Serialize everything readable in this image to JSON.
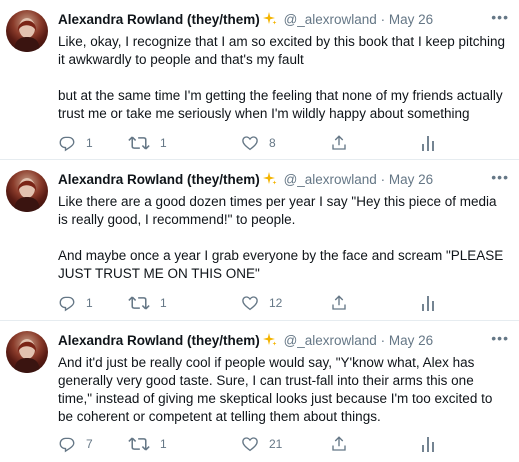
{
  "tweets": [
    {
      "author": "Alexandra Rowland (they/them)",
      "handle": "@_alexrowland",
      "separator": "·",
      "date": "May 26",
      "paragraphs": [
        "Like, okay, I recognize that I am so excited by this book that I keep pitching it awkwardly to people and that's my fault",
        "but at the same time I'm getting the feeling that none of my friends actually trust me or take me seriously when I'm wildly happy about something"
      ],
      "replies": "1",
      "retweets": "1",
      "likes": "8"
    },
    {
      "author": "Alexandra Rowland (they/them)",
      "handle": "@_alexrowland",
      "separator": "·",
      "date": "May 26",
      "paragraphs": [
        "Like there are a good dozen times per year I say \"Hey this piece of media is really good, I recommend!\" to people.",
        "And maybe once a year I grab everyone by the face and scream \"PLEASE JUST TRUST ME ON THIS ONE\""
      ],
      "replies": "1",
      "retweets": "1",
      "likes": "12"
    },
    {
      "author": "Alexandra Rowland (they/them)",
      "handle": "@_alexrowland",
      "separator": "·",
      "date": "May 26",
      "paragraphs": [
        "And it'd just be really cool if people would say, \"Y'know what, Alex has generally very good taste. Sure, I can trust-fall into their arms this one time,\" instead of giving me skeptical looks just because I'm too excited to be coherent or competent at telling them about things."
      ],
      "replies": "7",
      "retweets": "1",
      "likes": "21"
    }
  ],
  "icons": {
    "sparkle": "sparkles-icon",
    "reply": "reply-icon",
    "retweet": "retweet-icon",
    "like": "heart-icon",
    "share": "share-icon",
    "analytics": "analytics-icon",
    "more": "more-icon"
  },
  "colors": {
    "text": "#0f1419",
    "secondary": "#657786",
    "sparkle": "#f4b400",
    "divider": "#e6ecf0"
  }
}
